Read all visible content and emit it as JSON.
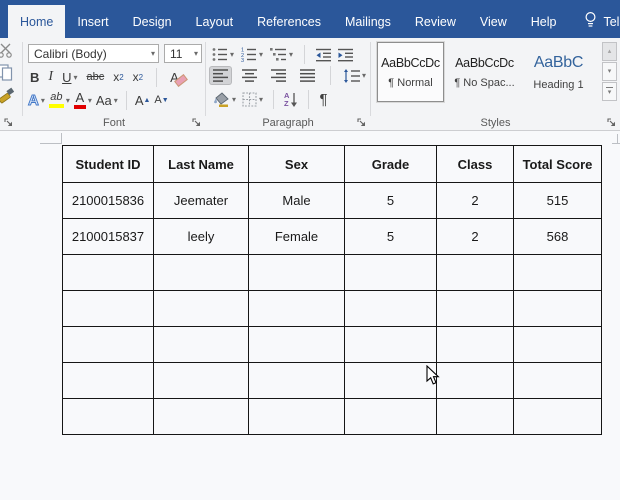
{
  "tab_bar": {
    "tabs": [
      {
        "label": "Home"
      },
      {
        "label": "Insert"
      },
      {
        "label": "Design"
      },
      {
        "label": "Layout"
      },
      {
        "label": "References"
      },
      {
        "label": "Mailings"
      },
      {
        "label": "Review"
      },
      {
        "label": "View"
      },
      {
        "label": "Help"
      }
    ],
    "active_tab": "Home",
    "tell_me": "Tell"
  },
  "ribbon": {
    "font_group": {
      "label": "Font",
      "font_name": "Calibri (Body)",
      "font_size": "11",
      "bold": "B",
      "italic": "I",
      "underline": "U",
      "strikethrough": "abc",
      "subscript_base": "x",
      "subscript_mark": "2",
      "superscript_base": "x",
      "superscript_mark": "2",
      "clear_formatting": "A",
      "text_effects": "A",
      "highlight": "ab",
      "font_color": "A",
      "change_case": "Aa",
      "grow_font": "A",
      "shrink_font": "A"
    },
    "paragraph_group": {
      "label": "Paragraph",
      "sort_top": "A",
      "sort_bottom": "Z",
      "pilcrow": "¶"
    },
    "styles_group": {
      "label": "Styles",
      "styles": [
        {
          "sample": "AaBbCcDc",
          "name": "¶ Normal"
        },
        {
          "sample": "AaBbCcDc",
          "name": "¶ No Spac..."
        },
        {
          "sample": "AaBbC",
          "name": "Heading 1"
        }
      ]
    }
  },
  "document": {
    "table": {
      "headers": [
        "Student ID",
        "Last Name",
        "Sex",
        "Grade",
        "Class",
        "Total Score"
      ],
      "rows": [
        [
          "2100015836",
          "Jeemater",
          "Male",
          "5",
          "2",
          "515"
        ],
        [
          "2100015837",
          "leely",
          "Female",
          "5",
          "2",
          "568"
        ],
        [
          "",
          "",
          "",
          "",
          "",
          ""
        ],
        [
          "",
          "",
          "",
          "",
          "",
          ""
        ],
        [
          "",
          "",
          "",
          "",
          "",
          ""
        ],
        [
          "",
          "",
          "",
          "",
          "",
          ""
        ],
        [
          "",
          "",
          "",
          "",
          "",
          ""
        ]
      ]
    }
  },
  "colors": {
    "ribbon_blue": "#2b579a",
    "heading_style_blue": "#33639c",
    "highlight_yellow": "#ffff00",
    "font_color_red": "#e00000"
  }
}
